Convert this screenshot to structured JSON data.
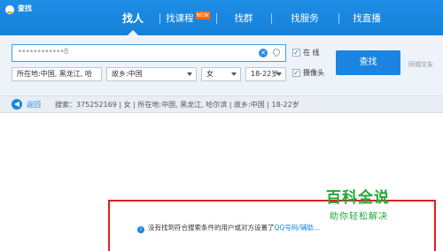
{
  "window": {
    "title": "查找",
    "icon": "app-icon"
  },
  "tabs": [
    {
      "label": "找人",
      "active": true
    },
    {
      "label": "找课程",
      "badge": "NEW"
    },
    {
      "label": "找群"
    },
    {
      "label": "找服务"
    },
    {
      "label": "找直播"
    }
  ],
  "search": {
    "value": "••••••••••••8",
    "clear_icon": "clear-icon",
    "location_icon": "location-pin-icon",
    "button_label": "查找"
  },
  "filters": {
    "location": "所在地:中国, 黑龙江, 哈",
    "hometown": "故乡:中国",
    "gender": "女",
    "age": "18-22岁",
    "online": {
      "label": "在  线",
      "checked": true
    },
    "camera": {
      "label": "摄像头",
      "checked": true
    }
  },
  "side_link": "同城交友",
  "summary": {
    "back_label": "返回",
    "text": "搜索：375252169 | 女 | 所在地:中国, 黑龙江, 哈尔滨 | 故乡:中国 | 18-22岁"
  },
  "result": {
    "notice_prefix": "没有找到符合搜索条件的用户或对方设置了",
    "notice_link": "QQ号码/辅助..."
  },
  "watermark": {
    "title": "百科全说",
    "subtitle": "助你轻松解决"
  },
  "colors": {
    "header": "#1e8ee6",
    "accent": "#1a84e0",
    "panel": "#eef3f9",
    "frame": "#e02020",
    "watermark": "#1ea83a"
  }
}
